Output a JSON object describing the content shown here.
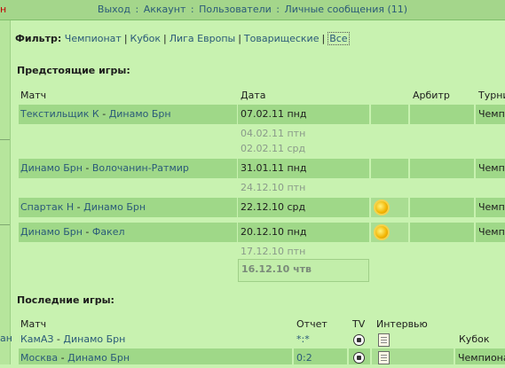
{
  "topbar": {
    "edge": "н",
    "links": [
      "Выход",
      "Аккаунт",
      "Пользователи",
      "Личные сообщения"
    ],
    "count": "(11)"
  },
  "leftstrip": {
    "label": "ан"
  },
  "filter": {
    "label": "Фильтр:",
    "items": [
      "Чемпионат",
      "Кубок",
      "Лига Европы",
      "Товарищеские",
      "Все"
    ]
  },
  "upcoming": {
    "title": "Предстоящие игры:",
    "headers": {
      "match": "Матч",
      "date": "Дата",
      "referee": "Арбитр",
      "tournament": "Турни"
    },
    "rows": [
      {
        "home": "Текстильщик К",
        "sep": " - ",
        "away": "Динамо Брн",
        "date": "07.02.11 пнд",
        "tour": "Чемп"
      },
      {
        "date": "04.02.11 птн"
      },
      {
        "date": "02.02.11 срд"
      },
      {
        "home": "Динамо Брн",
        "sep": " - ",
        "away": "Волочанин-Ратмир",
        "date": "31.01.11 пнд",
        "tour": "Чемп"
      },
      {
        "date": "24.12.10 птн"
      },
      {
        "home": "Спартак Н",
        "sep": " - ",
        "away": "Динамо Брн",
        "date": "22.12.10 срд",
        "tour": "Чемп"
      },
      {
        "home": "Динамо Брн",
        "sep": " - ",
        "away": "Факел",
        "date": "20.12.10 пнд",
        "tour": "Чемп"
      },
      {
        "date": "17.12.10 птн"
      },
      {
        "date": "16.12.10 чтв"
      }
    ]
  },
  "recent": {
    "title": "Последние игры:",
    "headers": {
      "match": "Матч",
      "report": "Отчет",
      "tv": "TV",
      "interview": "Интервью"
    },
    "rows": [
      {
        "home": "КамАЗ",
        "sep": " - ",
        "away": "Динамо Брн",
        "report": "*:*",
        "tour": "Кубок"
      },
      {
        "home": "Москва",
        "sep": " - ",
        "away": "Динамо Брн",
        "report": "0:2",
        "tour": "Чемпиона"
      }
    ]
  }
}
